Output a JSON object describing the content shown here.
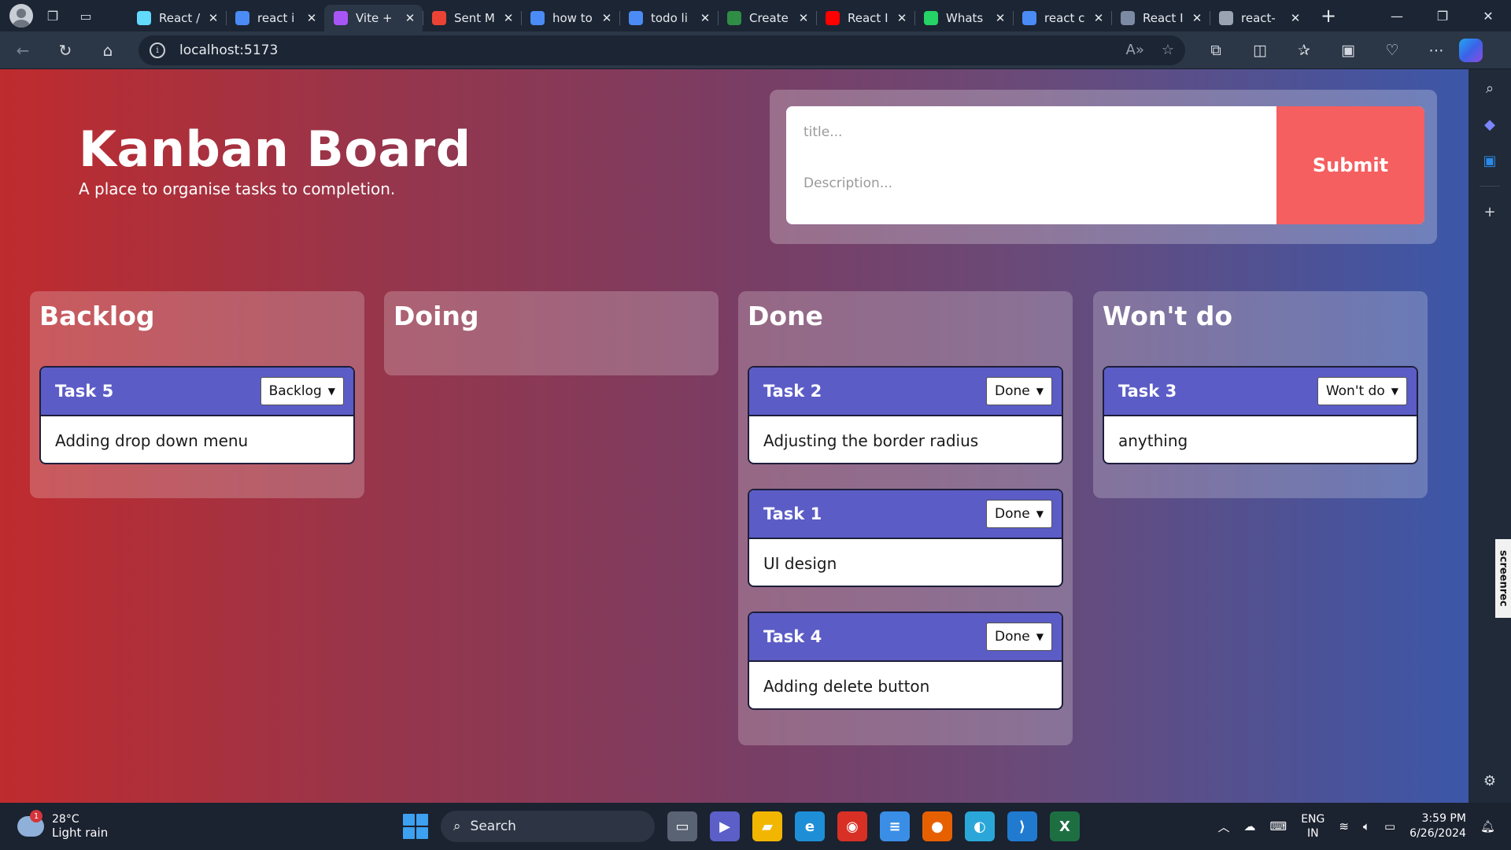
{
  "browser": {
    "tabs": [
      {
        "title": "React /",
        "favicon": "react-icon",
        "color": "#61dafb",
        "active": false
      },
      {
        "title": "react i",
        "favicon": "search-icon",
        "color": "#4b8bf5",
        "active": false
      },
      {
        "title": "Vite +",
        "favicon": "vite-icon",
        "color": "#a855f7",
        "active": true
      },
      {
        "title": "Sent M",
        "favicon": "gmail-icon",
        "color": "#ea4335",
        "active": false
      },
      {
        "title": "how to",
        "favicon": "search-icon",
        "color": "#4b8bf5",
        "active": false
      },
      {
        "title": "todo li",
        "favicon": "search-icon",
        "color": "#4b8bf5",
        "active": false
      },
      {
        "title": "Create",
        "favicon": "gfg-icon",
        "color": "#2f8d46",
        "active": false
      },
      {
        "title": "React I",
        "favicon": "youtube-icon",
        "color": "#ff0000",
        "active": false
      },
      {
        "title": "Whats",
        "favicon": "whatsapp-icon",
        "color": "#25d366",
        "active": false
      },
      {
        "title": "react c",
        "favicon": "search-icon",
        "color": "#4b8bf5",
        "active": false
      },
      {
        "title": "React I",
        "favicon": "dnd-icon",
        "color": "#7d8aa3",
        "active": false
      },
      {
        "title": "react-",
        "favicon": "page-icon",
        "color": "#9aa3b1",
        "active": false
      }
    ],
    "url": "localhost:5173"
  },
  "app": {
    "title": "Kanban Board",
    "subtitle": "A place to organise tasks to completion.",
    "form": {
      "title_placeholder": "title...",
      "description_placeholder": "Description...",
      "submit_label": "Submit"
    },
    "columns": [
      {
        "title": "Backlog",
        "tasks": [
          {
            "title": "Task 5",
            "status": "Backlog",
            "description": "Adding drop down menu"
          }
        ]
      },
      {
        "title": "Doing",
        "tasks": []
      },
      {
        "title": "Done",
        "tasks": [
          {
            "title": "Task 2",
            "status": "Done",
            "description": "Adjusting the border radius"
          },
          {
            "title": "Task 1",
            "status": "Done",
            "description": "UI design"
          },
          {
            "title": "Task 4",
            "status": "Done",
            "description": "Adding delete button"
          }
        ]
      },
      {
        "title": "Won't do",
        "tasks": [
          {
            "title": "Task 3",
            "status": "Won't do",
            "description": "anything"
          }
        ]
      }
    ]
  },
  "taskbar": {
    "weather_temp": "28°C",
    "weather_desc": "Light rain",
    "weather_badge": "1",
    "search_label": "Search",
    "lang_top": "ENG",
    "lang_bottom": "IN",
    "time": "3:59 PM",
    "date": "6/26/2024"
  },
  "sidebar": {
    "screenrec_label": "screenrec"
  }
}
